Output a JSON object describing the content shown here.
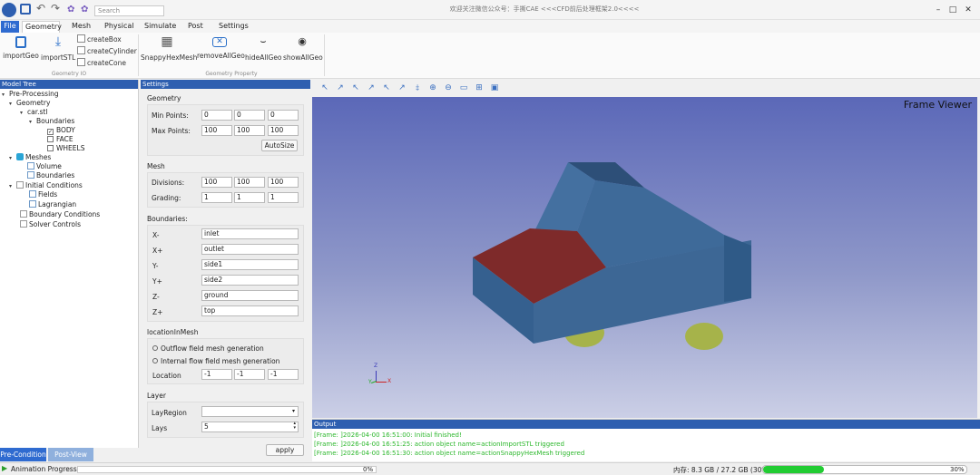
{
  "titlebar": {
    "search_placeholder": "Search",
    "title": "欢迎关注微信公众号：手撕CAE <<<CFD前后处理框架2.0<<<<",
    "buttons": [
      "minimize-icon",
      "maximize-icon",
      "close-icon"
    ]
  },
  "menu": {
    "file": "File",
    "items": [
      "Geometry",
      "Mesh",
      "Physical",
      "Simulate",
      "Post",
      "Settings"
    ]
  },
  "ribbon": {
    "import_geo": "importGeo",
    "import_stl": "importSTL",
    "create_box": "createBox",
    "create_cylinder": "createCylinder",
    "create_cone": "createCone",
    "group_io": "Geometry IO",
    "snappy": "SnappyHexMesh",
    "remove_all": "removeAllGeo",
    "hide_all": "hideAllGeo",
    "show_all": "showAllGeo",
    "group_property": "Geometry Property"
  },
  "tree": {
    "header": "Model Tree",
    "preprocessing": "Pre-Processing",
    "geometry": "Geometry",
    "car": "car.stl",
    "boundaries": "Boundaries",
    "body": "BODY",
    "face": "FACE",
    "wheels": "WHEELS",
    "meshes": "Meshes",
    "volume": "Volume",
    "mesh_boundaries": "Boundaries",
    "initial": "Initial Conditions",
    "fields": "Fields",
    "lagrangian": "Lagrangian",
    "boundary_conditions": "Boundary Conditions",
    "solver_controls": "Solver Controls"
  },
  "tabs": {
    "pre": "Pre-Condition",
    "post": "Post-View"
  },
  "settings": {
    "header": "Settings",
    "geometry": "Geometry",
    "min_points": "Min Points:",
    "min_values": [
      "0",
      "0",
      "0"
    ],
    "max_points": "Max Points:",
    "max_values": [
      "100",
      "100",
      "100"
    ],
    "autosize": "AutoSize",
    "mesh": "Mesh",
    "divisions": "Divisions:",
    "div_values": [
      "100",
      "100",
      "100"
    ],
    "grading": "Grading:",
    "grad_values": [
      "1",
      "1",
      "1"
    ],
    "boundaries": "Boundaries:",
    "bnd": [
      {
        "label": "X-",
        "value": "inlet"
      },
      {
        "label": "X+",
        "value": "outlet"
      },
      {
        "label": "Y-",
        "value": "side1"
      },
      {
        "label": "Y+",
        "value": "side2"
      },
      {
        "label": "Z-",
        "value": "ground"
      },
      {
        "label": "Z+",
        "value": "top"
      }
    ],
    "location_in_mesh": "locationInMesh",
    "outflow": "Outflow field  mesh generation",
    "internal": "Internal flow field mesh generation",
    "location": "Location",
    "loc_values": [
      "-1",
      "-1",
      "-1"
    ],
    "layer": "Layer",
    "lay_region": "LayRegion",
    "lays": "Lays",
    "lays_value": "5",
    "apply": "apply"
  },
  "viewer": {
    "label": "Frame Viewer",
    "axis_x": "X",
    "axis_y": "Y",
    "axis_z": "Z",
    "car_body_color": "#3d6795",
    "car_hood_color": "#7e2a2a",
    "wheel_color": "#a6b34a"
  },
  "output": {
    "header": "Output",
    "lines": [
      "[Frame: ]2026-04-00 16:51:00: Initial finished!",
      "[Frame: ]2026-04-00 16:51:25:  action object name=actionImportSTL triggered",
      "[Frame: ]2026-04-00 16:51:30:  action object name=actionSnappyHexMesh triggered"
    ]
  },
  "status": {
    "animation_label": "Animation Progress:",
    "animation_progress": 0,
    "animation_percent": "0%",
    "memory": "内存: 8.3 GB / 27.2 GB (30%)",
    "memory_fraction": 0.3,
    "memory_percent": "30%"
  }
}
